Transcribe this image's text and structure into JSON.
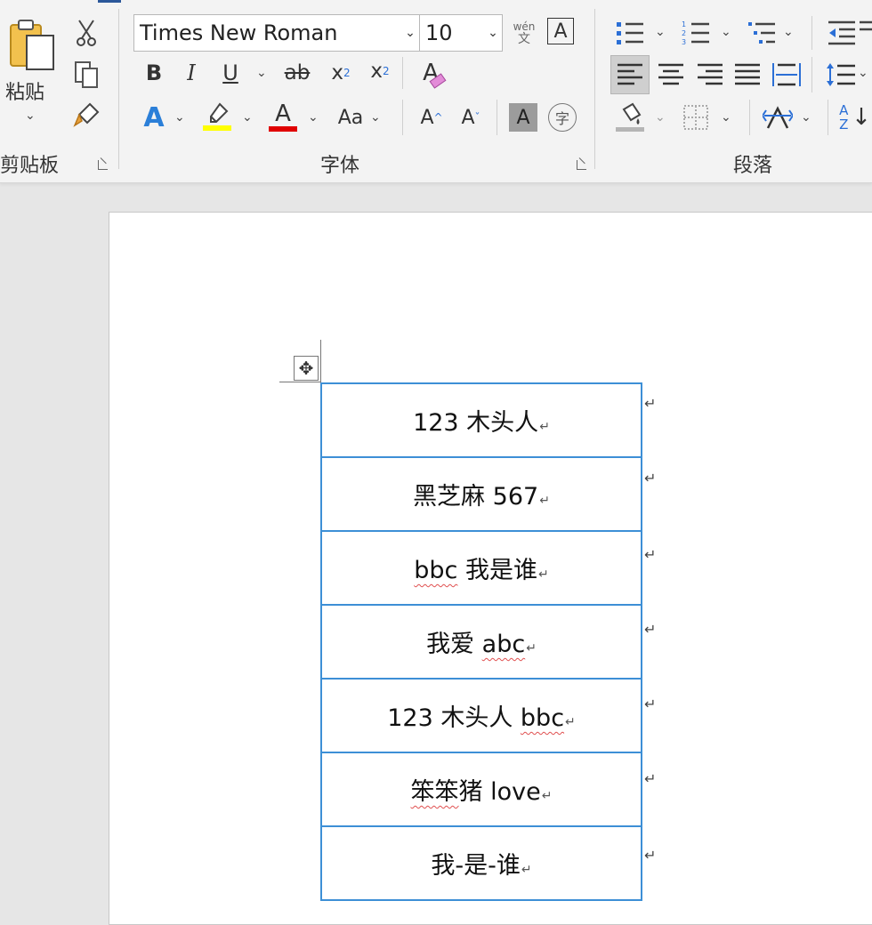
{
  "ribbon": {
    "clipboard": {
      "paste_label": "粘贴",
      "group_label": "剪贴板"
    },
    "font": {
      "font_name": "Times New Roman",
      "font_size": "10",
      "phonetic_top": "wén",
      "phonetic_bottom": "文",
      "bold": "B",
      "italic": "I",
      "underline": "U",
      "strikethrough": "ab",
      "subscript_base": "x",
      "subscript_mark": "2",
      "superscript_base": "x",
      "superscript_mark": "2",
      "char_border": "A",
      "clear_format": "A",
      "text_effect": "A",
      "font_color_letter": "A",
      "change_case": "Aa",
      "grow_font": "A",
      "shrink_font": "A",
      "char_shading": "A",
      "enclose_char": "字",
      "group_label": "字体",
      "highlight_color": "#ffff00",
      "font_color": "#e00000"
    },
    "paragraph": {
      "group_label": "段落",
      "sort_label": "A Z"
    }
  },
  "document": {
    "table_rows": [
      {
        "parts": [
          "123 木头人"
        ],
        "wavy": []
      },
      {
        "parts": [
          "黑芝麻 567"
        ],
        "wavy": []
      },
      {
        "parts": [
          "bbc",
          " 我是谁"
        ],
        "wavy": [
          0
        ]
      },
      {
        "parts": [
          "我爱 ",
          "abc"
        ],
        "wavy": [
          1
        ]
      },
      {
        "parts": [
          "123 木头人 ",
          "bbc"
        ],
        "wavy": [
          1
        ]
      },
      {
        "parts": [
          "笨笨",
          "猪 love"
        ],
        "wavy": [
          0
        ]
      },
      {
        "parts": [
          "我-是-谁"
        ],
        "wavy": []
      }
    ],
    "paragraph_mark": "↵",
    "move_handle": "✥"
  }
}
